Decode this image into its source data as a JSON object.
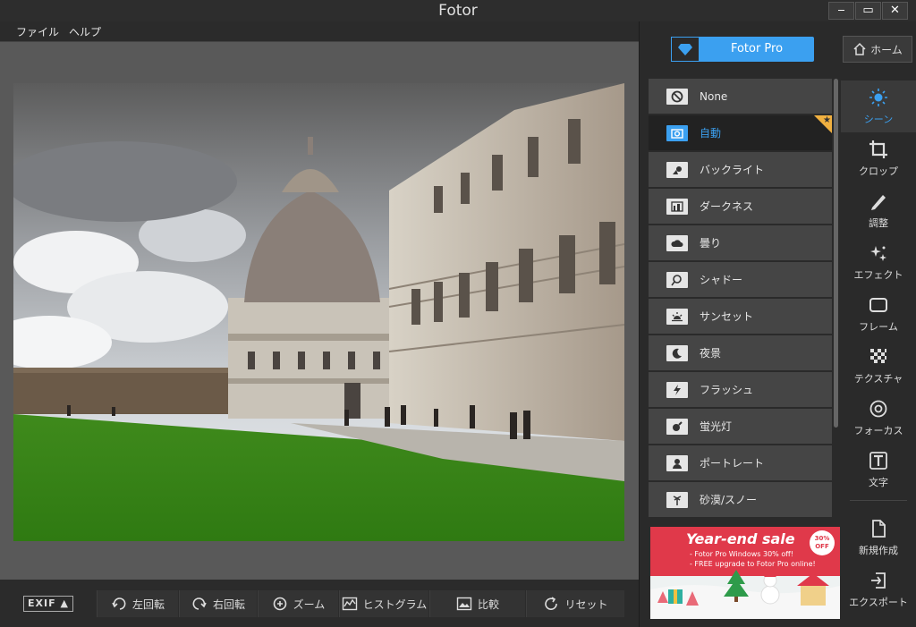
{
  "window": {
    "title": "Fotor",
    "controls": [
      "‒",
      "▭",
      "✕"
    ]
  },
  "menu": [
    "ファイル",
    "ヘルプ"
  ],
  "bottom": {
    "exif": "EXIF ▲",
    "buttons": [
      {
        "label": "左回転",
        "icon": "rotate-left-icon"
      },
      {
        "label": "右回転",
        "icon": "rotate-right-icon"
      },
      {
        "label": "ズーム",
        "icon": "zoom-icon"
      },
      {
        "label": "ヒストグラム",
        "icon": "histogram-icon"
      },
      {
        "label": "比較",
        "icon": "compare-icon"
      },
      {
        "label": "リセット",
        "icon": "reset-icon"
      }
    ]
  },
  "pro": {
    "label": "Fotor Pro",
    "icon": "diamond-icon"
  },
  "home": {
    "label": "ホーム",
    "icon": "home-icon"
  },
  "scenes": [
    {
      "label": "None",
      "icon": "none-icon",
      "active": false
    },
    {
      "label": "自動",
      "icon": "camera-icon",
      "active": true
    },
    {
      "label": "バックライト",
      "icon": "backlight-icon",
      "active": false
    },
    {
      "label": "ダークネス",
      "icon": "darkness-icon",
      "active": false
    },
    {
      "label": "曇り",
      "icon": "cloud-icon",
      "active": false
    },
    {
      "label": "シャドー",
      "icon": "shadow-icon",
      "active": false
    },
    {
      "label": "サンセット",
      "icon": "sunset-icon",
      "active": false
    },
    {
      "label": "夜景",
      "icon": "night-icon",
      "active": false
    },
    {
      "label": "フラッシュ",
      "icon": "flash-icon",
      "active": false
    },
    {
      "label": "蛍光灯",
      "icon": "fluorescent-icon",
      "active": false
    },
    {
      "label": "ポートレート",
      "icon": "portrait-icon",
      "active": false
    },
    {
      "label": "砂漠/スノー",
      "icon": "desert-snow-icon",
      "active": false
    }
  ],
  "ad": {
    "headline": "Year-end sale",
    "line1": "- Fotor Pro Windows 30% off!",
    "line2": "- FREE upgrade to Fotor Pro online!",
    "badge_pct": "30%",
    "badge_off": "OFF"
  },
  "tools": [
    {
      "label": "シーン",
      "icon": "scene-icon",
      "active": true
    },
    {
      "label": "クロップ",
      "icon": "crop-icon",
      "active": false
    },
    {
      "label": "調整",
      "icon": "adjust-icon",
      "active": false
    },
    {
      "label": "エフェクト",
      "icon": "effect-icon",
      "active": false
    },
    {
      "label": "フレーム",
      "icon": "frame-icon",
      "active": false
    },
    {
      "label": "テクスチャ",
      "icon": "texture-icon",
      "active": false
    },
    {
      "label": "フォーカス",
      "icon": "focus-icon",
      "active": false
    },
    {
      "label": "文字",
      "icon": "text-icon",
      "active": false
    }
  ],
  "bottom_tools": [
    {
      "label": "新規作成",
      "icon": "new-icon"
    },
    {
      "label": "エクスポート",
      "icon": "export-icon"
    }
  ],
  "colors": {
    "accent": "#3ba0f0",
    "panel": "#2a2a2a",
    "canvas": "#595959"
  }
}
